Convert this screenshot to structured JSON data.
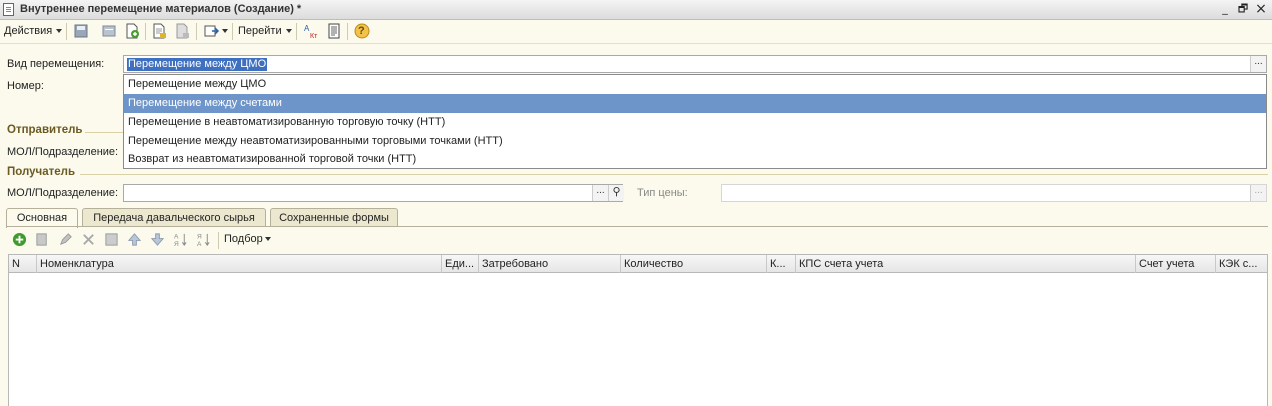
{
  "window": {
    "title": "Внутреннее перемещение материалов (Создание) *",
    "minimize_glyph": "_",
    "restore_glyph": "🗗",
    "close_glyph": "×"
  },
  "toolbar": {
    "actions_label": "Действия",
    "goto_label": "Перейти",
    "help_glyph": "?"
  },
  "form": {
    "movement_type_label": "Вид перемещения:",
    "movement_type_value": "Перемещение между ЦМО",
    "number_label": "Номер:",
    "sender_section": "Отправитель",
    "sender_mol_label": "МОЛ/Подразделение:",
    "recipient_section": "Получатель",
    "recipient_mol_label": "МОЛ/Подразделение:",
    "recipient_mol_value": "",
    "price_type_label": "Тип цены:",
    "price_type_value": "",
    "dots_glyph": "...",
    "search_glyph": "⚲"
  },
  "dropdown": {
    "items": [
      {
        "label": "Перемещение между ЦМО",
        "selected": false
      },
      {
        "label": "Перемещение между счетами",
        "selected": true
      },
      {
        "label": "Перемещение в неавтоматизированную торговую точку (НТТ)",
        "selected": false
      },
      {
        "label": "Перемещение между неавтоматизированными торговыми точками (НТТ)",
        "selected": false
      },
      {
        "label": "Возврат из неавтоматизированной торговой точки (НТТ)",
        "selected": false
      }
    ]
  },
  "tabs": [
    {
      "label": "Основная",
      "active": true
    },
    {
      "label": "Передача давальческого сырья",
      "active": false
    },
    {
      "label": "Сохраненные формы",
      "active": false
    }
  ],
  "table_toolbar": {
    "selection_label": "Подбор"
  },
  "table": {
    "columns": [
      "N",
      "Номенклатура",
      "Еди...",
      "Затребовано",
      "Количество",
      "К...",
      "КПС счета учета",
      "Счет учета",
      "КЭК с..."
    ],
    "rows": []
  },
  "colors": {
    "background": "#fbfaed",
    "section_title": "#6b5a22",
    "selection": "#3f6fbf",
    "dropdown_highlight": "#6e95c9"
  }
}
